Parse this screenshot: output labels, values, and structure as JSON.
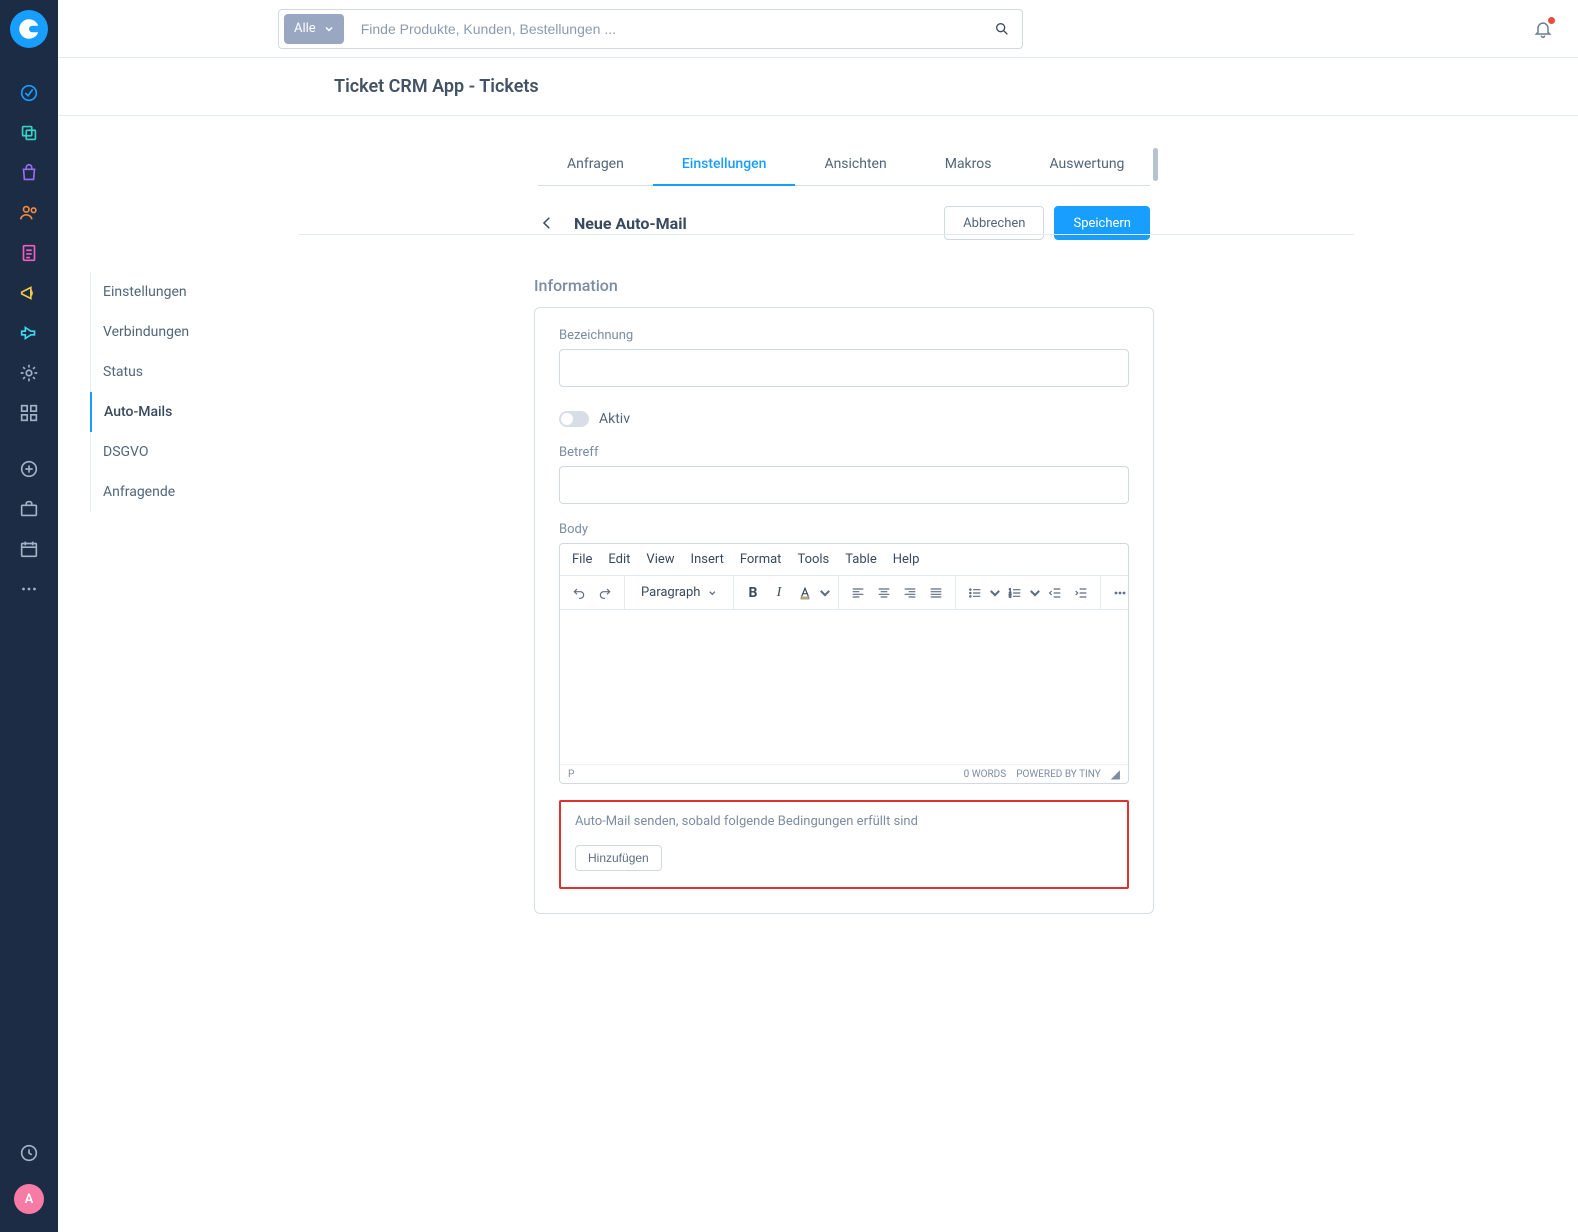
{
  "brand_color": "#189eff",
  "notification_color": "#e74c3c",
  "avatar_letter": "A",
  "search": {
    "filter_label": "Alle",
    "placeholder": "Finde Produkte, Kunden, Bestellungen ..."
  },
  "page_title": "Ticket CRM App - Tickets",
  "tabs": {
    "items": [
      {
        "label": "Anfragen"
      },
      {
        "label": "Einstellungen",
        "active": true
      },
      {
        "label": "Ansichten"
      },
      {
        "label": "Makros"
      },
      {
        "label": "Auswertung"
      }
    ]
  },
  "subheader": {
    "title": "Neue Auto-Mail",
    "cancel": "Abbrechen",
    "save": "Speichern"
  },
  "settings_menu": {
    "items": [
      {
        "label": "Einstellungen"
      },
      {
        "label": "Verbindungen"
      },
      {
        "label": "Status"
      },
      {
        "label": "Auto-Mails",
        "active": true
      },
      {
        "label": "DSGVO"
      },
      {
        "label": "Anfragende"
      }
    ]
  },
  "form": {
    "section_title": "Information",
    "fields": {
      "name_label": "Bezeichnung",
      "name_value": "",
      "active_label": "Aktiv",
      "subject_label": "Betreff",
      "subject_value": "",
      "body_label": "Body"
    },
    "editor": {
      "menus": [
        "File",
        "Edit",
        "View",
        "Insert",
        "Format",
        "Tools",
        "Table",
        "Help"
      ],
      "format_label": "Paragraph",
      "status_path": "P",
      "words": "0 WORDS",
      "powered": "POWERED BY TINY"
    },
    "rule": {
      "title": "Auto-Mail senden, sobald folgende Bedingungen erfüllt sind",
      "add_label": "Hinzufügen"
    }
  },
  "icons": {
    "sidebar": [
      "dashboard-icon",
      "copy-icon",
      "shop-icon",
      "users-icon",
      "invoice-icon",
      "marketing-icon",
      "plugin-icon",
      "settings-icon",
      "apps-icon",
      "add-icon",
      "briefcase-icon",
      "calendar-icon",
      "more-icon",
      "activity-icon"
    ]
  }
}
